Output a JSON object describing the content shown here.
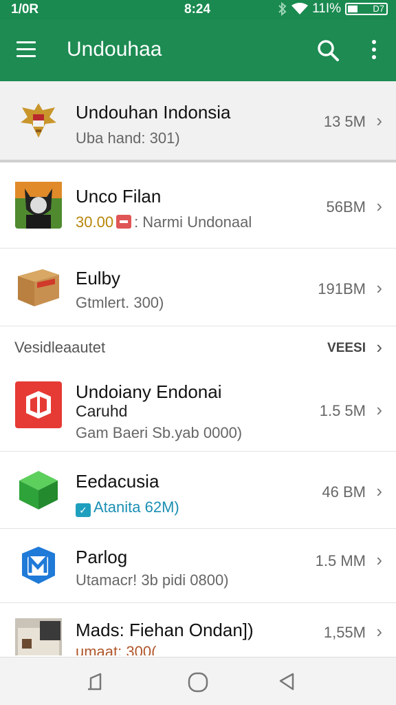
{
  "status_bar": {
    "left_text": "1/0R",
    "time": "8:24",
    "battery": "11I%",
    "battery_box": "D7"
  },
  "app_bar": {
    "title": "Undouhaa",
    "menu_icon": "hamburger-icon",
    "search_icon": "search-icon",
    "more_icon": "more-vert-icon",
    "color": "#1d8b52"
  },
  "featured": {
    "name": "Undouhan Indonsia",
    "sub": "Uba hand: 301)",
    "size": "13 5M",
    "icon": "garuda-emblem-icon"
  },
  "apps_top": [
    {
      "name": "Unco Filan",
      "price": "30.00",
      "sub": ": Narmi Undonaal",
      "size": "56BM",
      "icon": "cat-portrait-icon"
    },
    {
      "name": "Eulby",
      "sub": "Gtmlert.  300)",
      "size": "191BM",
      "icon": "cardboard-box-icon"
    }
  ],
  "section": {
    "label": "Vesidleaautet",
    "more": "VEESI"
  },
  "apps_bottom": [
    {
      "name": "Undoiany Endonai",
      "name2": "Caruhd",
      "sub": "Gam Baeri Sb.yab 0000)",
      "size": "1.5 5M",
      "icon": "red-cube-icon"
    },
    {
      "name": "Eedacusia",
      "sub": "Atanita 62M)",
      "size": "46 BM",
      "icon": "green-box-icon"
    },
    {
      "name": "Parlog",
      "sub": "Utamacr! 3b pidi 0800)",
      "size": "1.5 MM",
      "icon": "blue-m-cube-icon"
    },
    {
      "name": "Mads: Fiehan Ondan])",
      "sub": "umaat: 300(",
      "size": "1,55M",
      "icon": "house-photo-icon"
    }
  ],
  "nav": {
    "back": "back-icon",
    "home": "home-icon",
    "recents": "recents-icon"
  }
}
